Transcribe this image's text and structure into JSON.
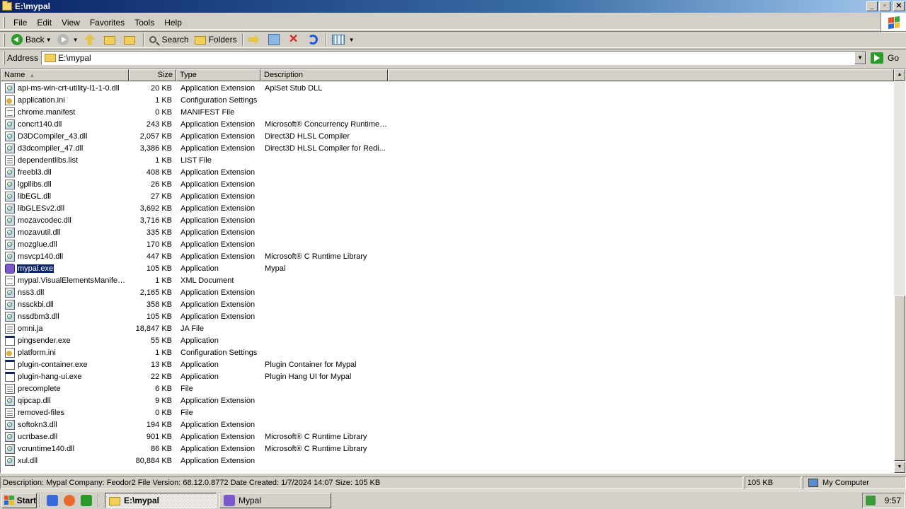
{
  "window": {
    "title": "E:\\mypal"
  },
  "menu": [
    "File",
    "Edit",
    "View",
    "Favorites",
    "Tools",
    "Help"
  ],
  "toolbar": {
    "back_label": "Back",
    "search_label": "Search",
    "folders_label": "Folders"
  },
  "address": {
    "label": "Address",
    "value": "E:\\mypal",
    "go_label": "Go"
  },
  "columns": {
    "name": "Name",
    "size": "Size",
    "type": "Type",
    "description": "Description"
  },
  "files": [
    {
      "name": "api-ms-win-crt-utility-l1-1-0.dll",
      "size": "20 KB",
      "type": "Application Extension",
      "description": "ApiSet Stub DLL",
      "icon": "dll"
    },
    {
      "name": "application.ini",
      "size": "1 KB",
      "type": "Configuration Settings",
      "description": "",
      "icon": "ini"
    },
    {
      "name": "chrome.manifest",
      "size": "0 KB",
      "type": "MANIFEST File",
      "description": "",
      "icon": "text"
    },
    {
      "name": "concrt140.dll",
      "size": "243 KB",
      "type": "Application Extension",
      "description": "Microsoft® Concurrency Runtime ...",
      "icon": "dll"
    },
    {
      "name": "D3DCompiler_43.dll",
      "size": "2,057 KB",
      "type": "Application Extension",
      "description": "Direct3D HLSL Compiler",
      "icon": "dll"
    },
    {
      "name": "d3dcompiler_47.dll",
      "size": "3,386 KB",
      "type": "Application Extension",
      "description": "Direct3D HLSL Compiler for Redi...",
      "icon": "dll"
    },
    {
      "name": "dependentlibs.list",
      "size": "1 KB",
      "type": "LIST File",
      "description": "",
      "icon": "generic"
    },
    {
      "name": "freebl3.dll",
      "size": "408 KB",
      "type": "Application Extension",
      "description": "",
      "icon": "dll"
    },
    {
      "name": "lgpllibs.dll",
      "size": "26 KB",
      "type": "Application Extension",
      "description": "",
      "icon": "dll"
    },
    {
      "name": "libEGL.dll",
      "size": "27 KB",
      "type": "Application Extension",
      "description": "",
      "icon": "dll"
    },
    {
      "name": "libGLESv2.dll",
      "size": "3,692 KB",
      "type": "Application Extension",
      "description": "",
      "icon": "dll"
    },
    {
      "name": "mozavcodec.dll",
      "size": "3,716 KB",
      "type": "Application Extension",
      "description": "",
      "icon": "dll"
    },
    {
      "name": "mozavutil.dll",
      "size": "335 KB",
      "type": "Application Extension",
      "description": "",
      "icon": "dll"
    },
    {
      "name": "mozglue.dll",
      "size": "170 KB",
      "type": "Application Extension",
      "description": "",
      "icon": "dll"
    },
    {
      "name": "msvcp140.dll",
      "size": "447 KB",
      "type": "Application Extension",
      "description": "Microsoft® C Runtime Library",
      "icon": "dll"
    },
    {
      "name": "mypal.exe",
      "size": "105 KB",
      "type": "Application",
      "description": "Mypal",
      "icon": "exe",
      "selected": true
    },
    {
      "name": "mypal.VisualElementsManifest....",
      "size": "1 KB",
      "type": "XML Document",
      "description": "",
      "icon": "text"
    },
    {
      "name": "nss3.dll",
      "size": "2,165 KB",
      "type": "Application Extension",
      "description": "",
      "icon": "dll"
    },
    {
      "name": "nssckbi.dll",
      "size": "358 KB",
      "type": "Application Extension",
      "description": "",
      "icon": "dll"
    },
    {
      "name": "nssdbm3.dll",
      "size": "105 KB",
      "type": "Application Extension",
      "description": "",
      "icon": "dll"
    },
    {
      "name": "omni.ja",
      "size": "18,847 KB",
      "type": "JA File",
      "description": "",
      "icon": "generic"
    },
    {
      "name": "pingsender.exe",
      "size": "55 KB",
      "type": "Application",
      "description": "",
      "icon": "app"
    },
    {
      "name": "platform.ini",
      "size": "1 KB",
      "type": "Configuration Settings",
      "description": "",
      "icon": "ini"
    },
    {
      "name": "plugin-container.exe",
      "size": "13 KB",
      "type": "Application",
      "description": "Plugin Container for Mypal",
      "icon": "app"
    },
    {
      "name": "plugin-hang-ui.exe",
      "size": "22 KB",
      "type": "Application",
      "description": "Plugin Hang UI for Mypal",
      "icon": "app"
    },
    {
      "name": "precomplete",
      "size": "6 KB",
      "type": "File",
      "description": "",
      "icon": "generic"
    },
    {
      "name": "qipcap.dll",
      "size": "9 KB",
      "type": "Application Extension",
      "description": "",
      "icon": "dll"
    },
    {
      "name": "removed-files",
      "size": "0 KB",
      "type": "File",
      "description": "",
      "icon": "generic"
    },
    {
      "name": "softokn3.dll",
      "size": "194 KB",
      "type": "Application Extension",
      "description": "",
      "icon": "dll"
    },
    {
      "name": "ucrtbase.dll",
      "size": "901 KB",
      "type": "Application Extension",
      "description": "Microsoft® C Runtime Library",
      "icon": "dll"
    },
    {
      "name": "vcruntime140.dll",
      "size": "86 KB",
      "type": "Application Extension",
      "description": "Microsoft® C Runtime Library",
      "icon": "dll"
    },
    {
      "name": "xul.dll",
      "size": "80,884 KB",
      "type": "Application Extension",
      "description": "",
      "icon": "dll"
    }
  ],
  "status": {
    "description": "Description: Mypal Company: Feodor2 File Version: 68.12.0.8772 Date Created: 1/7/2024 14:07 Size: 105 KB",
    "size": "105 KB",
    "zone": "My Computer"
  },
  "taskbar": {
    "start_label": "Start",
    "tasks": [
      {
        "label": "E:\\mypal",
        "active": true
      },
      {
        "label": "Mypal",
        "active": false
      }
    ],
    "clock": "9:57"
  },
  "colors": {
    "titlebar": "#0a246a",
    "face": "#d4d0c8",
    "selection": "#0a246a"
  }
}
